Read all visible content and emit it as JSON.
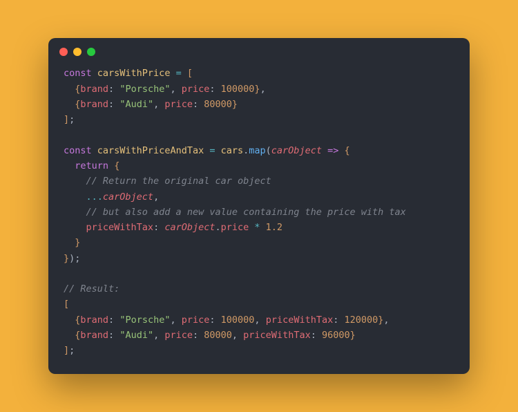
{
  "titlebar": {
    "dots": [
      "red",
      "yellow",
      "green"
    ]
  },
  "code": {
    "line1": {
      "kw": "const",
      "sp": " ",
      "var": "carsWithPrice",
      "op": " = ",
      "brace": "["
    },
    "line2": {
      "indent": "  ",
      "ob": "{",
      "prop1": "brand",
      "colon1": ": ",
      "str1": "\"Porsche\"",
      "comma1": ", ",
      "prop2": "price",
      "colon2": ": ",
      "num1": "100000",
      "cb": "}",
      "tc": ","
    },
    "line3": {
      "indent": "  ",
      "ob": "{",
      "prop1": "brand",
      "colon1": ": ",
      "str1": "\"Audi\"",
      "comma1": ", ",
      "prop2": "price",
      "colon2": ": ",
      "num1": "80000",
      "cb": "}"
    },
    "line4": {
      "brace": "]",
      "semi": ";"
    },
    "blank1": "",
    "line5": {
      "kw": "const",
      "sp": " ",
      "var": "carsWithPriceAndTax",
      "op": " = ",
      "obj": "cars",
      "dot": ".",
      "fn": "map",
      "op1": "(",
      "param": "carObject",
      "arrow": " => ",
      "ob": "{"
    },
    "line6": {
      "indent": "  ",
      "kw": "return",
      "sp": " ",
      "ob": "{"
    },
    "line7": {
      "indent": "    ",
      "comment": "// Return the original car object"
    },
    "line8": {
      "indent": "    ",
      "spread": "...",
      "param": "carObject",
      "comma": ","
    },
    "line9": {
      "indent": "    ",
      "comment": "// but also add a new value containing the price with tax"
    },
    "line10": {
      "indent": "    ",
      "prop": "priceWithTax",
      "colon": ": ",
      "param": "carObject",
      "dot": ".",
      "prop2": "price",
      "op": " * ",
      "num": "1.2"
    },
    "line11": {
      "indent": "  ",
      "cb": "}"
    },
    "line12": {
      "cb": "}",
      "cp": ")",
      "semi": ";"
    },
    "blank2": "",
    "line13": {
      "comment": "// Result:"
    },
    "line14": {
      "brace": "["
    },
    "line15": {
      "indent": "  ",
      "ob": "{",
      "p1": "brand",
      "c1": ": ",
      "s1": "\"Porsche\"",
      "cm1": ", ",
      "p2": "price",
      "c2": ": ",
      "n1": "100000",
      "cm2": ", ",
      "p3": "priceWithTax",
      "c3": ": ",
      "n2": "120000",
      "cb": "}",
      "tc": ","
    },
    "line16": {
      "indent": "  ",
      "ob": "{",
      "p1": "brand",
      "c1": ": ",
      "s1": "\"Audi\"",
      "cm1": ", ",
      "p2": "price",
      "c2": ": ",
      "n1": "80000",
      "cm2": ", ",
      "p3": "priceWithTax",
      "c3": ": ",
      "n2": "96000",
      "cb": "}"
    },
    "line17": {
      "brace": "]",
      "semi": ";"
    }
  }
}
